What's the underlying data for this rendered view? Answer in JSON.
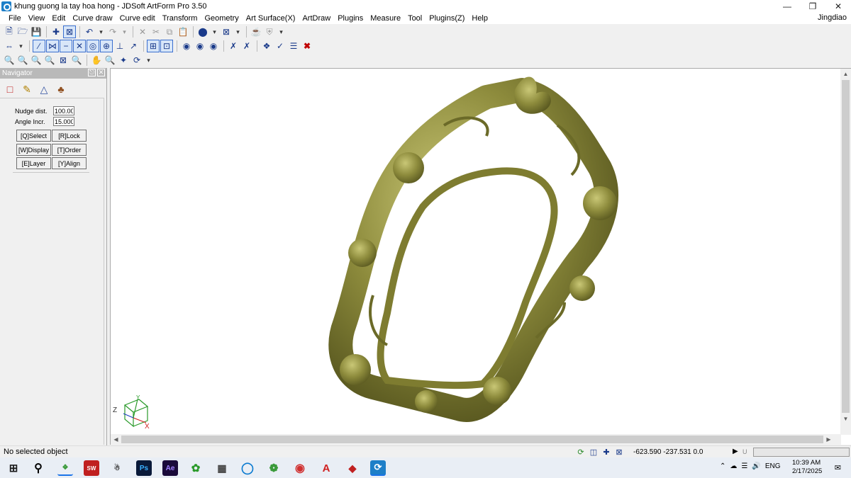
{
  "window": {
    "title": "khung guong la tay hoa hong - JDSoft ArtForm Pro 3.50",
    "user": "Jingdiao"
  },
  "menu": [
    "File",
    "View",
    "Edit",
    "Curve draw",
    "Curve edit",
    "Transform",
    "Geometry",
    "Art Surface(X)",
    "ArtDraw",
    "Plugins",
    "Measure",
    "Tool",
    "Plugins(Z)",
    "Help"
  ],
  "navigator": {
    "title": "Navigator",
    "nudge_label": "Nudge dist.",
    "nudge_value": "100.000",
    "angle_label": "Angle Incr.",
    "angle_value": "15.000",
    "buttons": {
      "select": "[Q]Select",
      "lock": "[R]Lock",
      "display": "[W]Display",
      "order": "[T]Order",
      "layer": "[E]Layer",
      "align": "[Y]Align"
    }
  },
  "viewport": {
    "axis_labels": {
      "x": "X",
      "y": "Y",
      "z": "Z"
    },
    "model_color": "#8a8a3a"
  },
  "status": {
    "text": "No selected object",
    "coords": "-623.590 -237.531 0.0",
    "u_label": "U",
    "progress_fraction": 0.0
  },
  "taskbar": {
    "language": "ENG",
    "time": "10:39 AM",
    "date": "2/17/2025"
  }
}
